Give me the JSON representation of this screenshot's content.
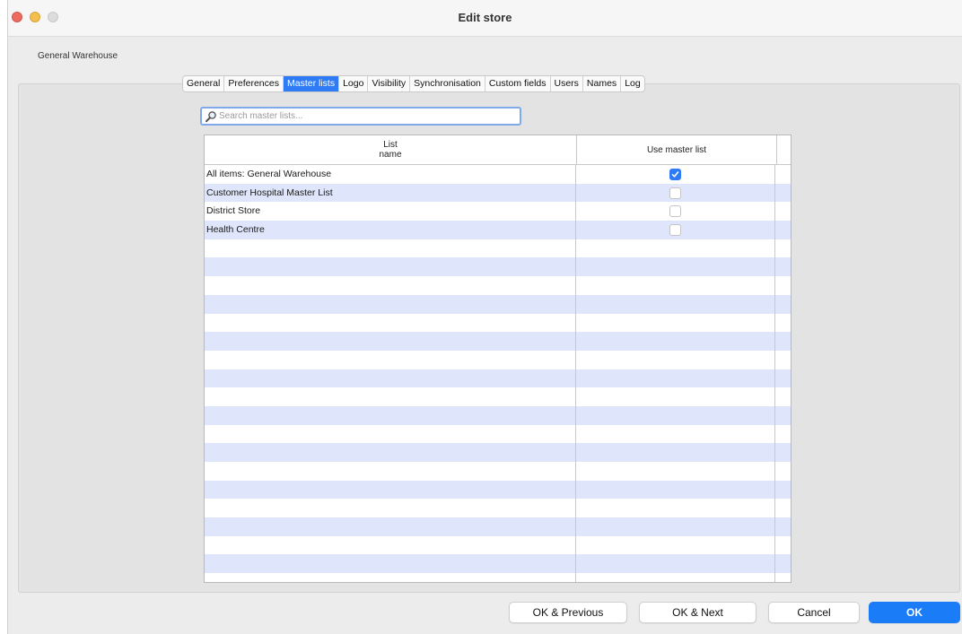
{
  "window": {
    "title": "Edit store",
    "controls": [
      "close",
      "minimize",
      "zoom"
    ]
  },
  "store_name": "General Warehouse",
  "tabs": [
    {
      "label": "General",
      "active": false
    },
    {
      "label": "Preferences",
      "active": false
    },
    {
      "label": "Master lists",
      "active": true
    },
    {
      "label": "Logo",
      "active": false
    },
    {
      "label": "Visibility",
      "active": false
    },
    {
      "label": "Synchronisation",
      "active": false
    },
    {
      "label": "Custom fields",
      "active": false
    },
    {
      "label": "Users",
      "active": false
    },
    {
      "label": "Names",
      "active": false
    },
    {
      "label": "Log",
      "active": false
    }
  ],
  "search": {
    "placeholder": "Search master lists...",
    "value": ""
  },
  "table": {
    "columns": {
      "list_name_line1": "List",
      "list_name_line2": "name",
      "use_master_list": "Use master list"
    },
    "rows": [
      {
        "name": "All items: General Warehouse",
        "use": true
      },
      {
        "name": "Customer Hospital Master List",
        "use": false
      },
      {
        "name": "District Store",
        "use": false
      },
      {
        "name": "Health Centre",
        "use": false
      }
    ],
    "empty_row_count": 19
  },
  "buttons": {
    "ok_previous": "OK & Previous",
    "ok_next": "OK & Next",
    "cancel": "Cancel",
    "ok": "OK"
  },
  "colors": {
    "accent": "#2f7bf5",
    "alt_row": "#dfe6fb",
    "primary_button": "#1a7cf6"
  },
  "icons": {
    "search": "search-icon",
    "check": "checkmark-icon"
  }
}
